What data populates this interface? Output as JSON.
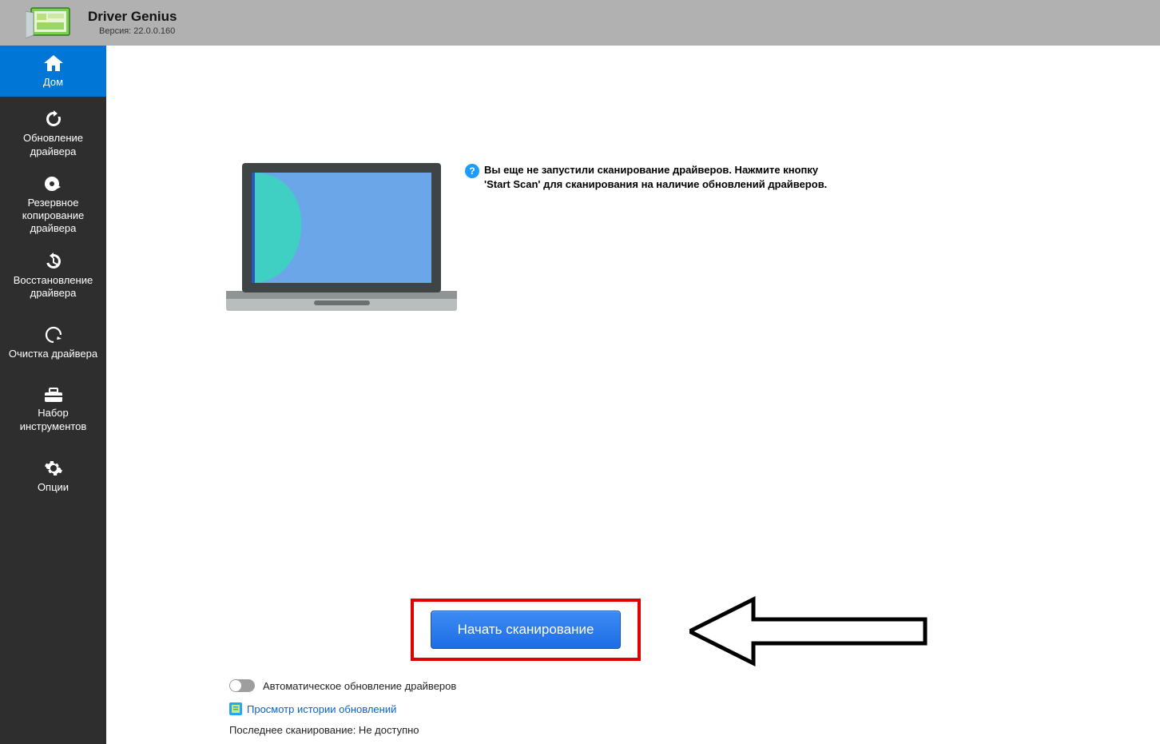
{
  "header": {
    "title": "Driver Genius",
    "version": "Версия: 22.0.0.160"
  },
  "sidebar": {
    "items": [
      {
        "label": "Дом"
      },
      {
        "label": "Обновление драйвера"
      },
      {
        "label": "Резервное копирование драйвера"
      },
      {
        "label": "Восстановление драйвера"
      },
      {
        "label": "Очистка драйвера"
      },
      {
        "label": "Набор инструментов"
      },
      {
        "label": "Опции"
      }
    ]
  },
  "main": {
    "info_icon": "?",
    "info_text": "Вы еще не запустили сканирование драйверов. Нажмите кнопку 'Start Scan' для сканирования на наличие обновлений драйверов.",
    "scan_button": "Начать  сканирование",
    "toggle_label": "Автоматическое обновление драйверов",
    "history_link": "Просмотр истории обновлений",
    "last_scan": "Последнее сканирование: Не доступно"
  }
}
